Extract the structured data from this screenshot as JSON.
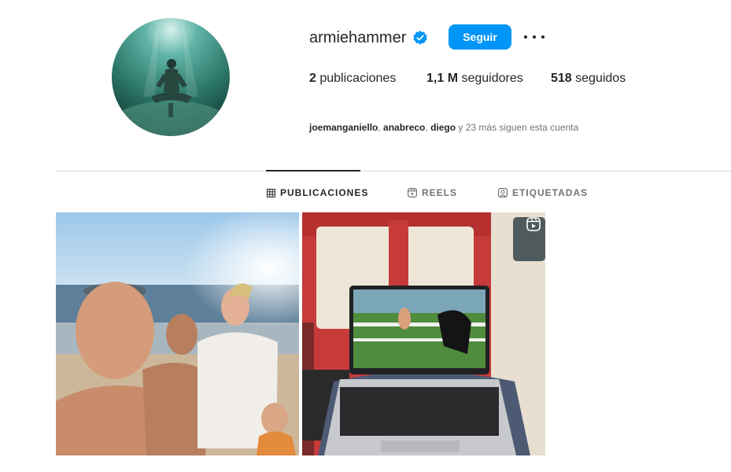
{
  "profile": {
    "username": "armiehammer",
    "verified": true,
    "follow_label": "Seguir",
    "more_icon": "more-horizontal-icon"
  },
  "stats": {
    "posts_count": "2",
    "posts_label": "publicaciones",
    "followers_count": "1,1 M",
    "followers_label": "seguidores",
    "following_count": "518",
    "following_label": "seguidos"
  },
  "followed_by": {
    "names": [
      "joemanganiello",
      "anabreco",
      "diego"
    ],
    "separator": ", ",
    "suffix": " y 23 más siguen esta cuenta"
  },
  "tabs": [
    {
      "label": "PUBLICACIONES",
      "icon": "grid-icon",
      "active": true
    },
    {
      "label": "REELS",
      "icon": "reels-icon",
      "active": false
    },
    {
      "label": "ETIQUETADAS",
      "icon": "tagged-icon",
      "active": false
    }
  ],
  "posts": [
    {
      "kind": "photo",
      "subject": "beach-selfie"
    },
    {
      "kind": "reel",
      "subject": "laptop-on-train",
      "badge_icon": "reel-icon"
    }
  ],
  "colors": {
    "accent": "#0095f6",
    "verified": "#0095f6",
    "text": "#262626",
    "muted": "#737373",
    "divider": "#dbdbdb"
  }
}
